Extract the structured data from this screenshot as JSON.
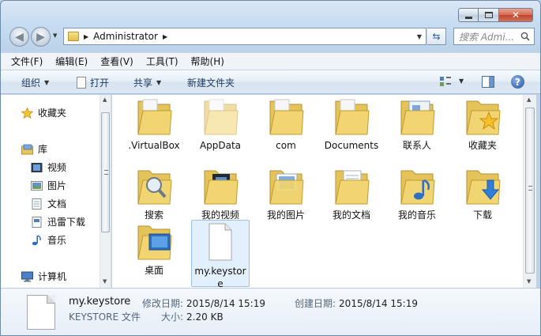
{
  "window": {
    "close_glyph": "✕"
  },
  "address": {
    "path": "Administrator"
  },
  "search": {
    "placeholder": "搜索 Admi..."
  },
  "menu": [
    "文件(F)",
    "编辑(E)",
    "查看(V)",
    "工具(T)",
    "帮助(H)"
  ],
  "toolbar": {
    "organize": "组织",
    "open": "打开",
    "share": "共享",
    "new_folder": "新建文件夹",
    "help_glyph": "?"
  },
  "nav": {
    "favorites": "收藏夹",
    "libraries": "库",
    "items": [
      "视频",
      "图片",
      "文档",
      "迅雷下载",
      "音乐"
    ],
    "computer": "计算机"
  },
  "files": [
    {
      "name": ".VirtualBox",
      "kind": "folder"
    },
    {
      "name": "AppData",
      "kind": "folder-faded"
    },
    {
      "name": "com",
      "kind": "folder"
    },
    {
      "name": "Documents",
      "kind": "folder"
    },
    {
      "name": "联系人",
      "kind": "folder-contacts"
    },
    {
      "name": "收藏夹",
      "kind": "folder-favorites"
    },
    {
      "name": "搜索",
      "kind": "folder-search"
    },
    {
      "name": "我的视频",
      "kind": "folder-videos"
    },
    {
      "name": "我的图片",
      "kind": "folder-pictures"
    },
    {
      "name": "我的文档",
      "kind": "folder-documents"
    },
    {
      "name": "我的音乐",
      "kind": "folder-music"
    },
    {
      "name": "下载",
      "kind": "folder-downloads"
    },
    {
      "name": "桌面",
      "kind": "folder-desktop"
    },
    {
      "name": "my.keystore",
      "kind": "file"
    }
  ],
  "details": {
    "name": "my.keystore",
    "type": "KEYSTORE 文件",
    "modified_label": "修改日期:",
    "modified": "2015/8/14 15:19",
    "created_label": "创建日期:",
    "created": "2015/8/14 15:19",
    "size_label": "大小:",
    "size": "2.20 KB"
  }
}
